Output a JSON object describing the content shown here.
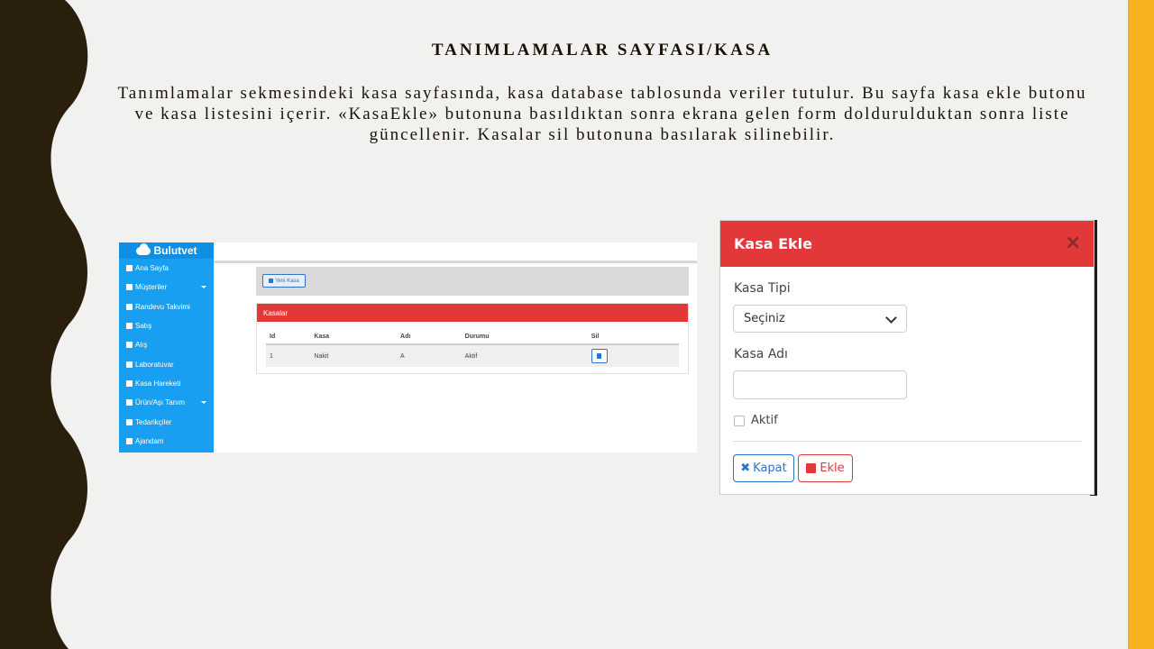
{
  "slide": {
    "title": "TANIMLAMALAR SAYFASI/KASA",
    "body": "Tanımlamalar sekmesindeki kasa sayfasında, kasa database tablosunda veriler tutulur. Bu sayfa kasa ekle butonu ve kasa listesini içerir. «KasaEkle» butonuna basıldıktan sonra ekrana gelen form doldurulduktan sonra liste güncellenir. Kasalar sil butonuna basılarak silinebilir.",
    "colors": {
      "wave": "#2a1f0d",
      "accent_bar": "#f5b120",
      "background": "#f1f1ef"
    }
  },
  "app": {
    "brand": "Bulutvet",
    "nav": [
      {
        "label": "Ana Sayfa",
        "icon": "home-icon"
      },
      {
        "label": "Müşteriler",
        "icon": "users-icon",
        "has_submenu": true
      },
      {
        "label": "Randevu Takvimi",
        "icon": "calendar-icon"
      },
      {
        "label": "Satış",
        "icon": "cart-icon"
      },
      {
        "label": "Alış",
        "icon": "truck-icon"
      },
      {
        "label": "Laboratuvar",
        "icon": "flask-icon"
      },
      {
        "label": "Kasa Hareketi",
        "icon": "money-icon"
      },
      {
        "label": "Ürün/Aşı Tanım",
        "icon": "sitemap-icon",
        "has_submenu": true
      },
      {
        "label": "Tedarikçiler",
        "icon": "parachute-icon"
      },
      {
        "label": "Ajandam",
        "icon": "bell-icon"
      }
    ],
    "new_button": "Yeni Kasa",
    "list_title": "Kasalar",
    "table": {
      "headers": [
        "Id",
        "Kasa",
        "Adı",
        "Durumu",
        "Sil"
      ],
      "rows": [
        {
          "id": "1",
          "kasa": "Nakit",
          "adi": "A",
          "durumu": "Aktif"
        }
      ]
    },
    "accent_red": "#e2383a",
    "sidebar_blue": "#189ff1"
  },
  "modal": {
    "title": "Kasa Ekle",
    "close_symbol": "×",
    "kasa_tipi_label": "Kasa Tipi",
    "kasa_tipi_value": "Seçiniz",
    "kasa_adi_label": "Kasa Adı",
    "kasa_adi_value": "",
    "aktif_label": "Aktif",
    "aktif_checked": false,
    "close_button": "Kapat",
    "close_button_icon": "✖",
    "add_button": "Ekle"
  }
}
